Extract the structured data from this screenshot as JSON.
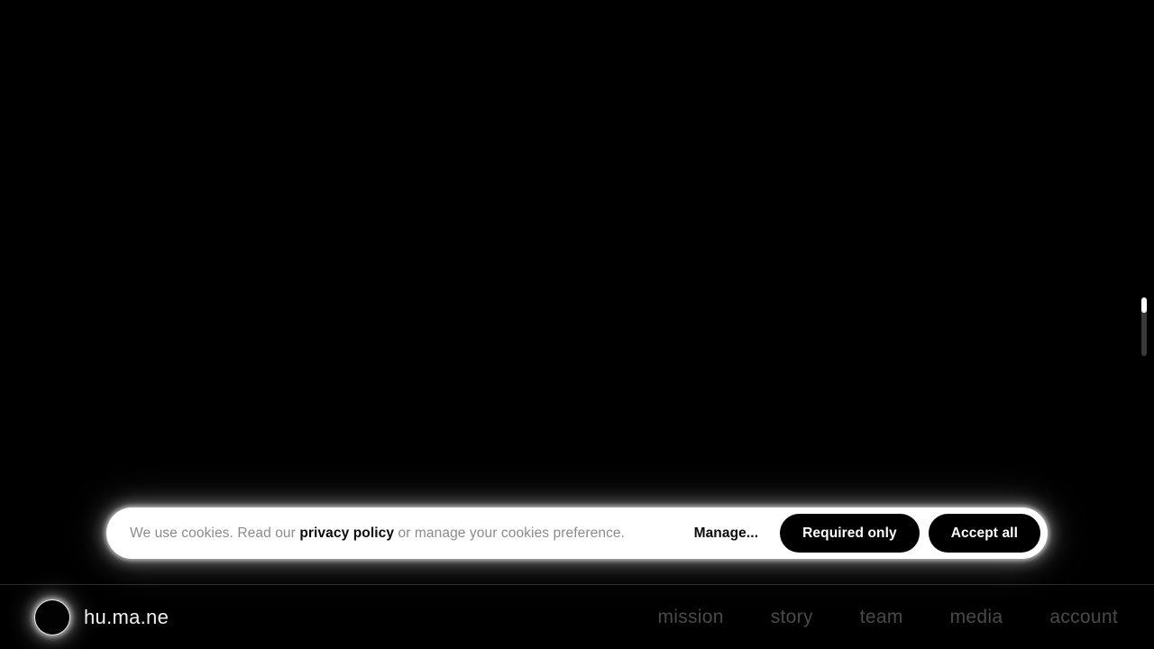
{
  "page": {
    "background_color": "#000000",
    "title": "hu.ma.ne"
  },
  "scrollbar": {
    "name": "vertical-scrollbar",
    "track_color": "#3a3a3a",
    "thumb_color": "#ffffff"
  },
  "cookie_banner": {
    "text_before_link": "We use cookies. Read our ",
    "link_label": "privacy policy",
    "text_after_link": " or manage your cookies preference.",
    "background_color": "#ffffff",
    "text_color": "#8b8b8b",
    "manage_label": "Manage...",
    "required_only_label": "Required only",
    "accept_all_label": "Accept all",
    "button_background": "#000000",
    "button_text_color": "#ffffff"
  },
  "footer": {
    "brand_name": "hu.ma.ne",
    "logo_icon": "eclipse-circle-icon",
    "nav": [
      {
        "label": "mission"
      },
      {
        "label": "story"
      },
      {
        "label": "team"
      },
      {
        "label": "media"
      },
      {
        "label": "account"
      }
    ],
    "nav_color": "#4a4a4a",
    "divider_color": "#2b2b2b"
  }
}
